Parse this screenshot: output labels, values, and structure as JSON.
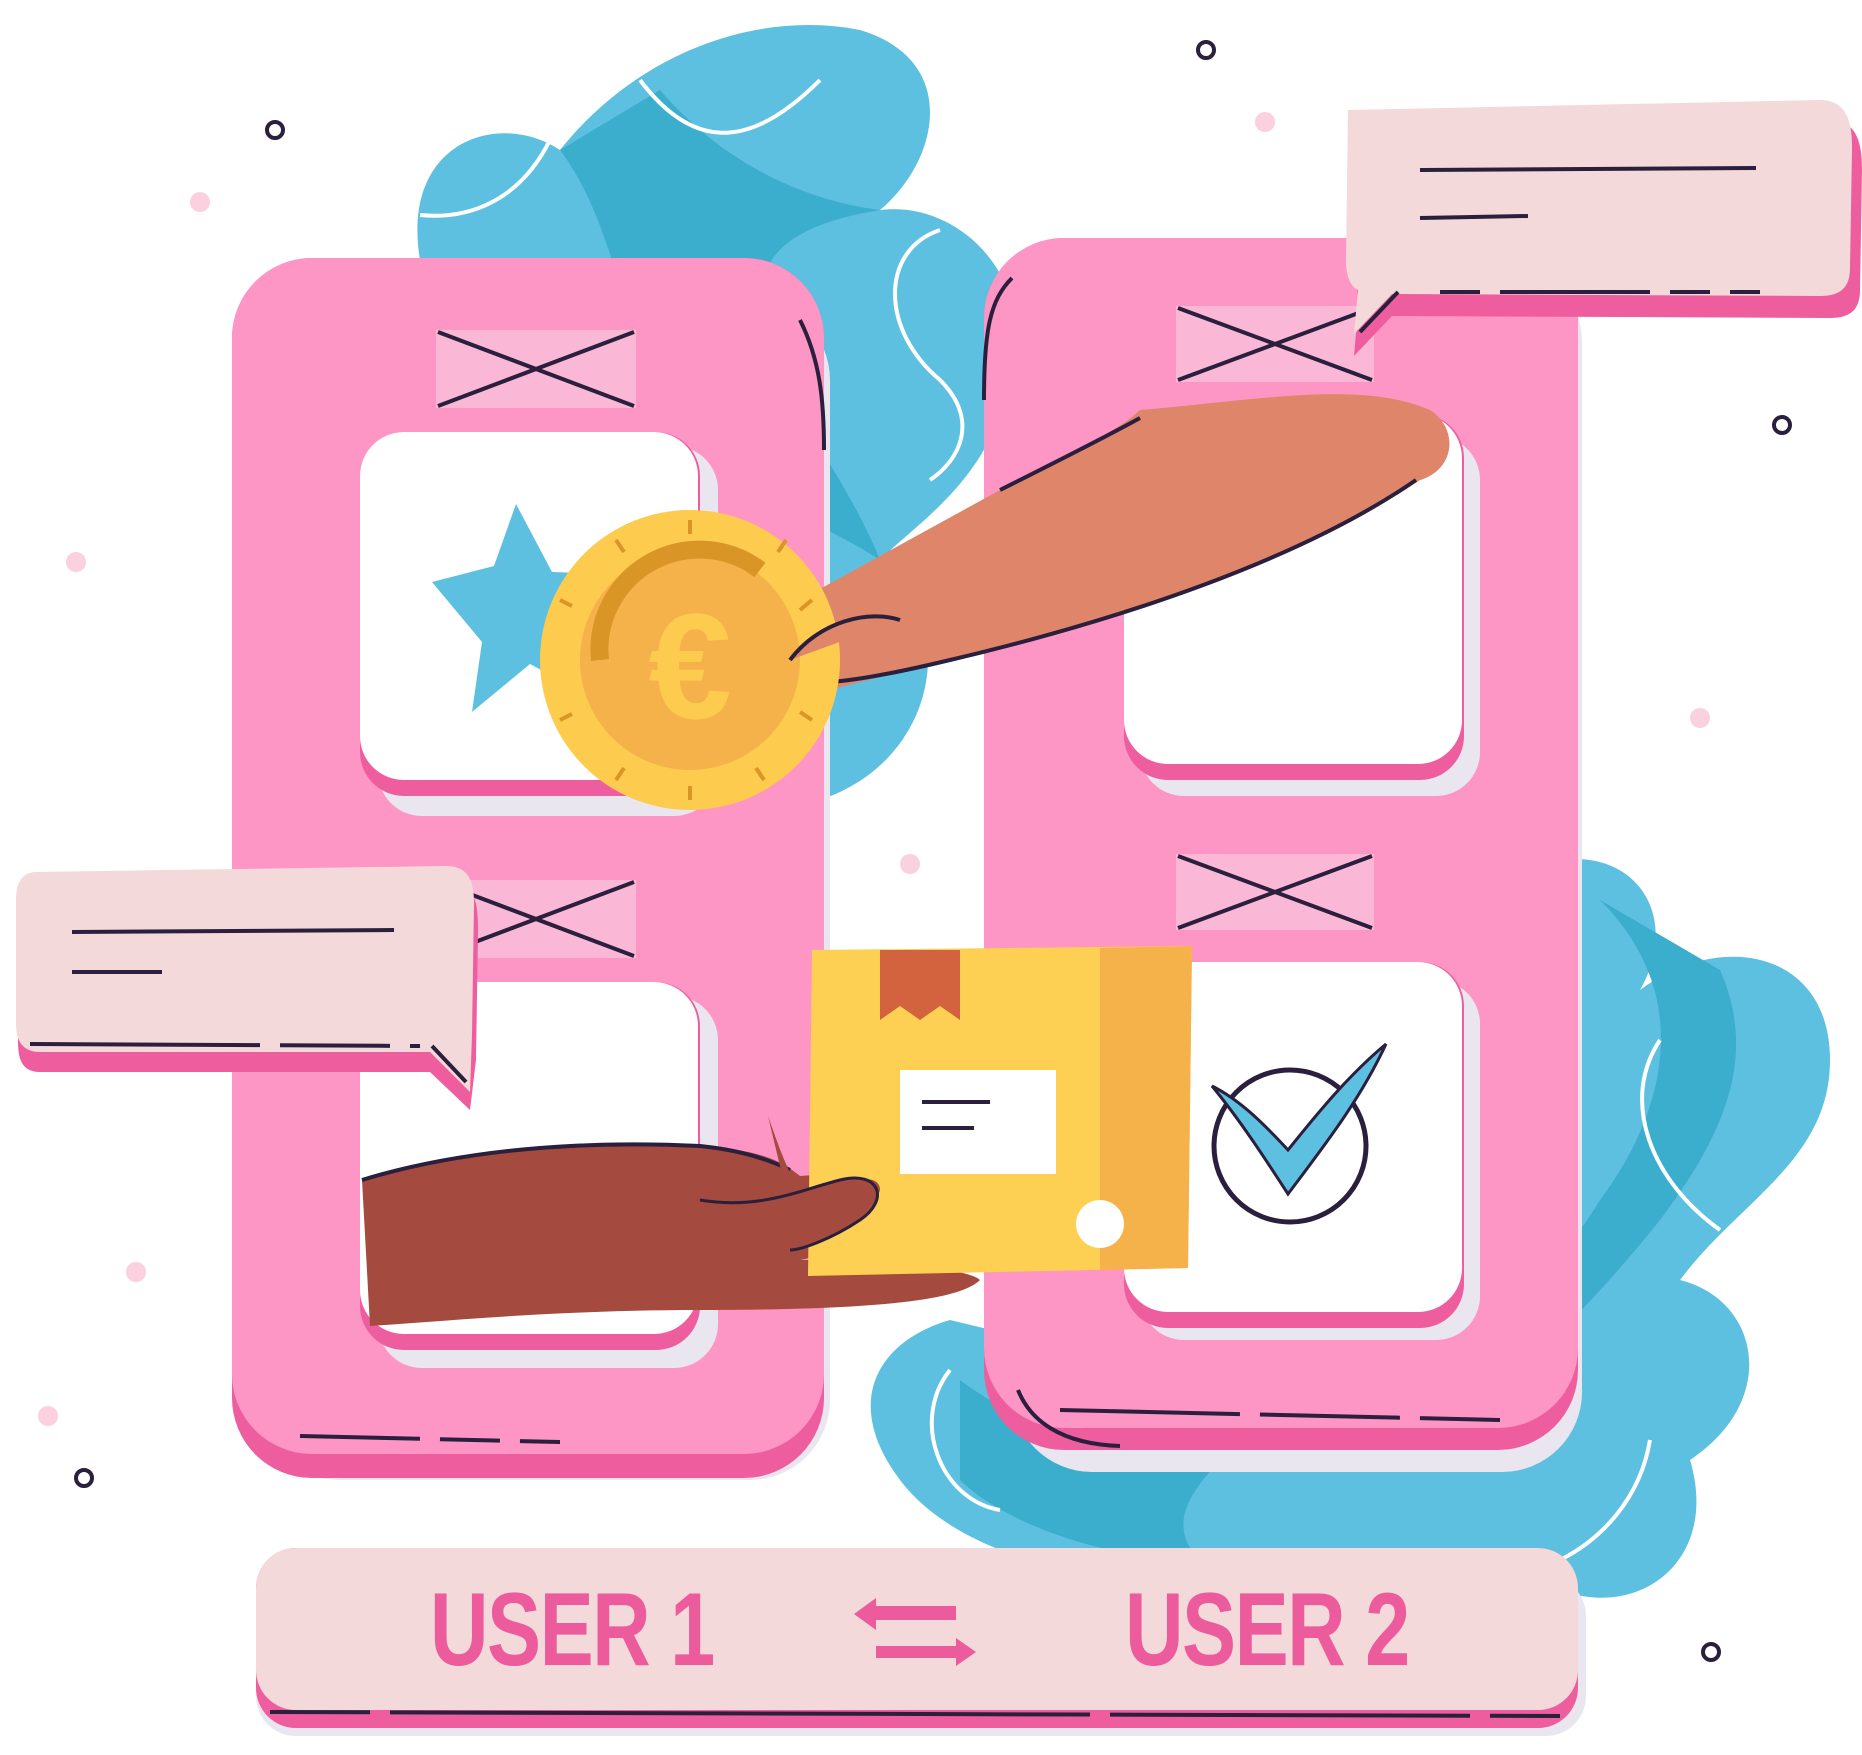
{
  "users": {
    "left_label": "USER 1",
    "right_label": "USER 2"
  },
  "icons": {
    "currency": "euro-coin-icon",
    "favorite": "star-icon",
    "confirm": "check-circle-icon",
    "exchange": "swap-arrows-icon",
    "package": "package-box-icon"
  },
  "colors": {
    "phone_pink": "#fd96c5",
    "phone_shadow": "#ee5e9e",
    "leaf_blue": "#5ec0e0",
    "leaf_blue_dark": "#3badcd",
    "bubble": "#f3d9da",
    "label_pink": "#ec5c9c",
    "coin_gold": "#fdcb4e",
    "box_yellow": "#fdcf52",
    "hand_light": "#df856a",
    "hand_dark": "#a54a3e",
    "outline": "#2a1f3d"
  }
}
